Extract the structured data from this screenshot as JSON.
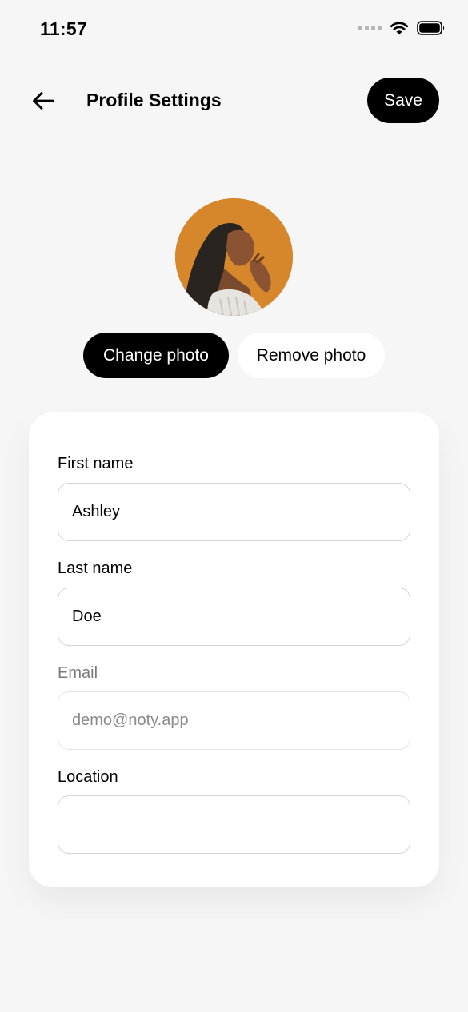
{
  "status_bar": {
    "time": "11:57",
    "icons": [
      "signal-icon",
      "wifi-icon",
      "battery-icon"
    ]
  },
  "header": {
    "title": "Profile Settings",
    "back_icon": "arrow-left-icon",
    "save_label": "Save"
  },
  "avatar": {
    "icon": "profile-photo"
  },
  "photo_actions": {
    "change_label": "Change photo",
    "remove_label": "Remove photo"
  },
  "form": {
    "first_name": {
      "label": "First name",
      "value": "Ashley"
    },
    "last_name": {
      "label": "Last name",
      "value": "Doe"
    },
    "email": {
      "label": "Email",
      "placeholder": "demo@noty.app",
      "value": ""
    },
    "location": {
      "label": "Location",
      "value": ""
    }
  },
  "colors": {
    "background": "#f6f6f6",
    "primary": "#000000",
    "card": "#ffffff",
    "avatar_bg": "#d6862b"
  }
}
